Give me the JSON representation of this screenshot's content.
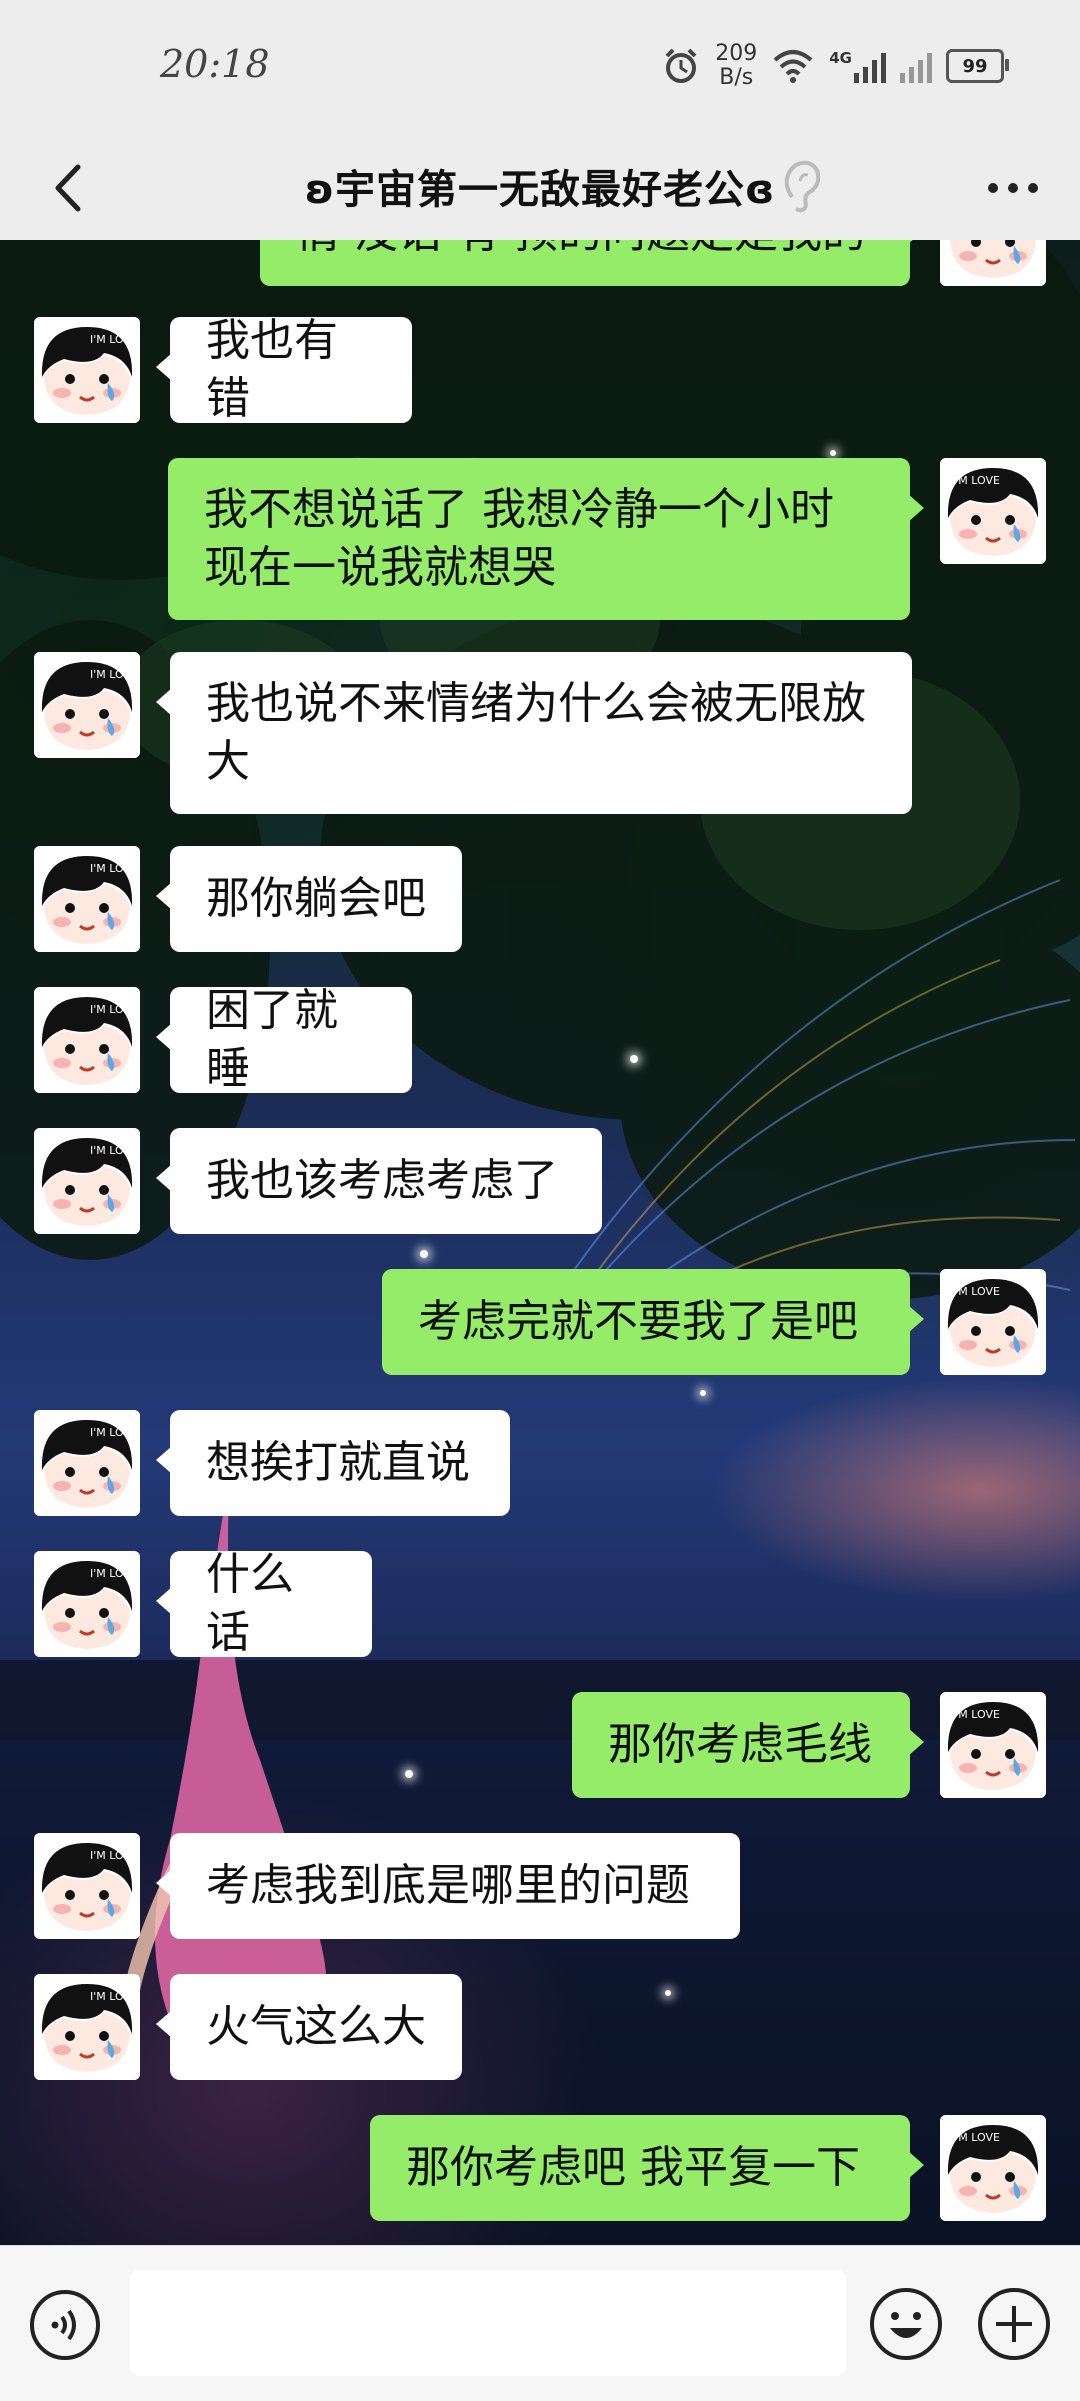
{
  "status_bar": {
    "time": "20:18",
    "speed_value": "209",
    "speed_unit": "B/s",
    "network": "4G",
    "battery": "99"
  },
  "nav": {
    "title": "ʚ宇宙第一无敌最好老公ɞ"
  },
  "messages": [
    {
      "side": "out",
      "lines": [
        "情 没话 有 预的问题走是我的"
      ]
    },
    {
      "side": "in",
      "lines": [
        "我也有错"
      ]
    },
    {
      "side": "out",
      "lines": [
        "我不想说话了 我想冷静一个小时",
        "现在一说我就想哭"
      ]
    },
    {
      "side": "in",
      "lines": [
        "我也说不来情绪为什么会被无限放",
        "大"
      ]
    },
    {
      "side": "in",
      "lines": [
        "那你躺会吧"
      ]
    },
    {
      "side": "in",
      "lines": [
        "困了就睡"
      ]
    },
    {
      "side": "in",
      "lines": [
        "我也该考虑考虑了"
      ]
    },
    {
      "side": "out",
      "lines": [
        "考虑完就不要我了是吧"
      ]
    },
    {
      "side": "in",
      "lines": [
        "想挨打就直说"
      ]
    },
    {
      "side": "in",
      "lines": [
        "什么话"
      ]
    },
    {
      "side": "out",
      "lines": [
        "那你考虑毛线"
      ]
    },
    {
      "side": "in",
      "lines": [
        "考虑我到底是哪里的问题"
      ]
    },
    {
      "side": "in",
      "lines": [
        "火气这么大"
      ]
    },
    {
      "side": "out",
      "lines": [
        "那你考虑吧 我平复一下"
      ]
    }
  ],
  "avatar_text": "I'M LOVE",
  "icons": {
    "back": "chevron-left-icon",
    "ear": "ear-icon",
    "more": "more-icon",
    "voice": "voice-icon",
    "emoji": "emoji-icon",
    "plus": "plus-icon"
  },
  "colors": {
    "out_bubble": "#95ec69",
    "in_bubble": "#ffffff",
    "bar_bg": "#ededed"
  }
}
